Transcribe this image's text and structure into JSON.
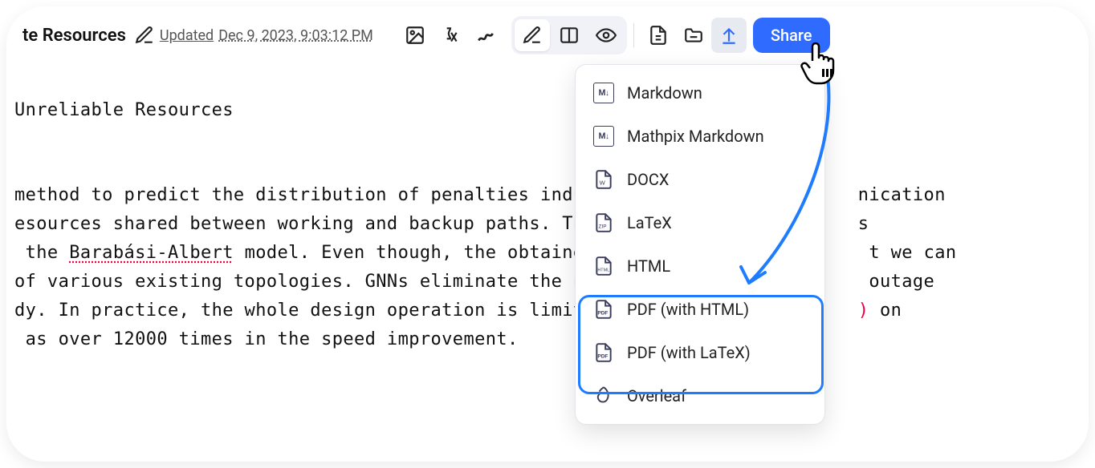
{
  "header": {
    "title_fragment": "te Resources",
    "updated_label": "Updated",
    "timestamp": "Dec 9, 2023, 9:03:12 PM",
    "share_label": "Share"
  },
  "content": {
    "heading": "Unreliable Resources",
    "line1a": "method to predict the distribution of penalties indu",
    "line1b": "nication",
    "line2a": "esources shared between working and backup paths. Th",
    "line2b": "s",
    "line3a": " the ",
    "line3_ba": "Barabási-Albert",
    "line3b": " model. Even though, the obtaine",
    "line3c": "t we can",
    "line4a": "of various existing topologies. GNNs eliminate the n",
    "line4b": "outage",
    "line5a": "dy. In practice, the whole design operation is limit",
    "line5b_paren": ")",
    "line5c": " on",
    "line6": " as over 12000 times in the speed improvement."
  },
  "export_menu": {
    "items": [
      {
        "label": "Markdown",
        "icon": "md"
      },
      {
        "label": "Mathpix Markdown",
        "icon": "md"
      },
      {
        "label": "DOCX",
        "icon": "docx"
      },
      {
        "label": "LaTeX",
        "icon": "zip"
      },
      {
        "label": "HTML",
        "icon": "html"
      },
      {
        "label": "PDF (with HTML)",
        "icon": "pdf"
      },
      {
        "label": "PDF (with LaTeX)",
        "icon": "pdf"
      },
      {
        "label": "Overleaf",
        "icon": "overleaf"
      }
    ]
  }
}
